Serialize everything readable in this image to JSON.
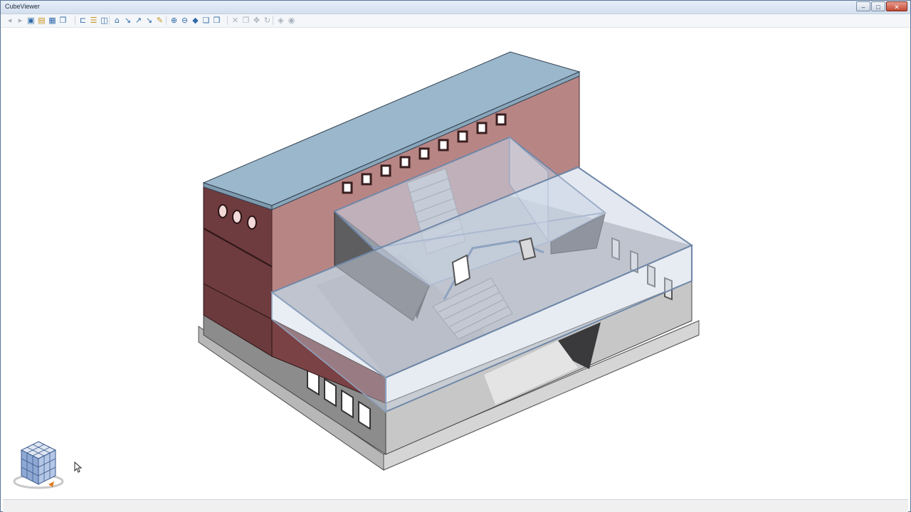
{
  "window": {
    "title": "CubeViewer"
  },
  "window_controls": {
    "minimize": "–",
    "maximize": "□",
    "close": "✕"
  },
  "toolbar": {
    "groups": [
      {
        "name": "file",
        "icons": [
          "back-icon",
          "forward-icon",
          "save-icon",
          "open-icon",
          "print-icon",
          "copy-view-icon"
        ]
      },
      {
        "name": "sections",
        "icons": [
          "section-x-icon",
          "section-y-icon",
          "section-box-icon"
        ]
      },
      {
        "name": "navigate",
        "icons": [
          "home-icon",
          "walk-icon",
          "fly-icon",
          "look-icon",
          "measure-icon"
        ]
      },
      {
        "name": "zoom",
        "icons": [
          "zoom-in-icon",
          "zoom-out-icon",
          "shading-icon",
          "layers-icon",
          "properties-icon"
        ]
      },
      {
        "name": "edit",
        "icons": [
          "delete-icon",
          "duplicate-icon",
          "move-icon",
          "rotate-icon"
        ]
      },
      {
        "name": "render",
        "icons": [
          "render-icon",
          "settings-icon"
        ]
      }
    ]
  },
  "colors": {
    "roof": "#9bb7cc",
    "brick_wall": "#b88585",
    "dark_brick": "#6b3a3c",
    "glass": "#c6d3e4",
    "concrete": "#c9c9c9",
    "accent": "#2f6aa8"
  },
  "view_cube": {
    "icon": "view-cube-icon",
    "compass_icon": "compass-ring-icon"
  },
  "cursor": {
    "icon": "mouse-pointer-icon"
  }
}
